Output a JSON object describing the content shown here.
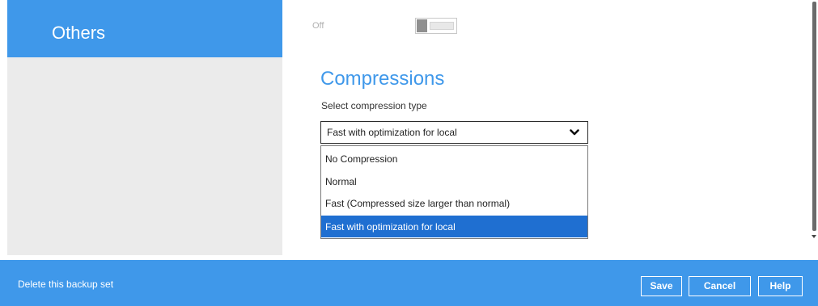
{
  "sidebar": {
    "active_item": "Others"
  },
  "settings": {
    "toggle_state_label": "Off"
  },
  "compression": {
    "section_title": "Compressions",
    "field_label": "Select compression type",
    "selected_value": "Fast with optimization for local",
    "options": [
      "No Compression",
      "Normal",
      "Fast (Compressed size larger than normal)",
      "Fast with optimization for local"
    ],
    "highlighted_option": "Fast with optimization for local"
  },
  "footer": {
    "delete_link": "Delete this backup set",
    "save_label": "Save",
    "cancel_label": "Cancel",
    "help_label": "Help"
  },
  "colors": {
    "accent": "#3f98ea",
    "selection": "#1f6fd1",
    "sidebar_bg": "#ebebeb"
  }
}
